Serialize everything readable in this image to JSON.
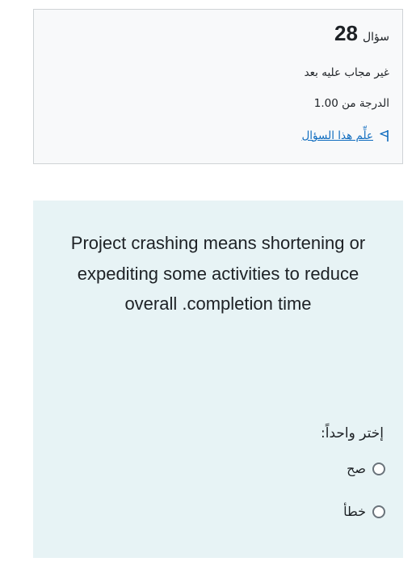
{
  "question_info": {
    "label": "سؤال",
    "number": "28",
    "state": "غير مجاب عليه بعد",
    "grade": "الدرجة من 1.00",
    "flag_label": "علِّم هذا السؤال"
  },
  "question": {
    "text": "Project crashing means shortening or expediting some activities to reduce overall .completion time",
    "prompt": "إختر واحداً:",
    "answers": [
      {
        "label": "صح"
      },
      {
        "label": "خطأ"
      }
    ]
  },
  "colors": {
    "link": "#0f6cbf",
    "content_bg": "#e7f3f5",
    "info_bg": "#f8f9fa"
  }
}
